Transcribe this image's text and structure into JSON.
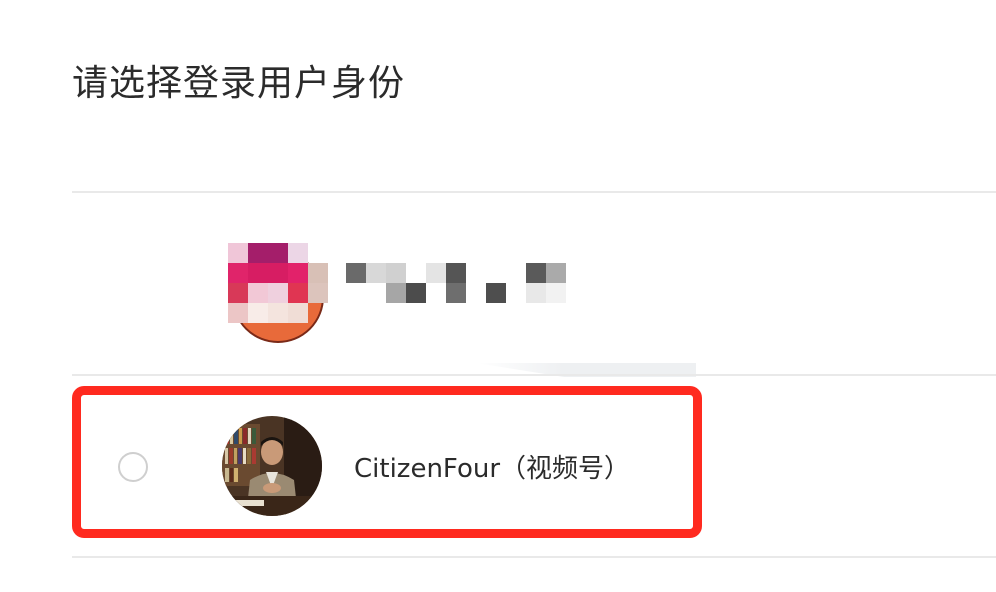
{
  "page": {
    "title": "请选择登录用户身份"
  },
  "accounts": [
    {
      "name": "",
      "obscured": true
    },
    {
      "name": "CitizenFour（视频号）",
      "selected": false,
      "highlighted": true
    }
  ],
  "colors": {
    "highlight_border": "#ff2a1f",
    "divider": "#e9e9e9",
    "text": "#2b2b2b",
    "radio_border": "#cfcfcf"
  }
}
